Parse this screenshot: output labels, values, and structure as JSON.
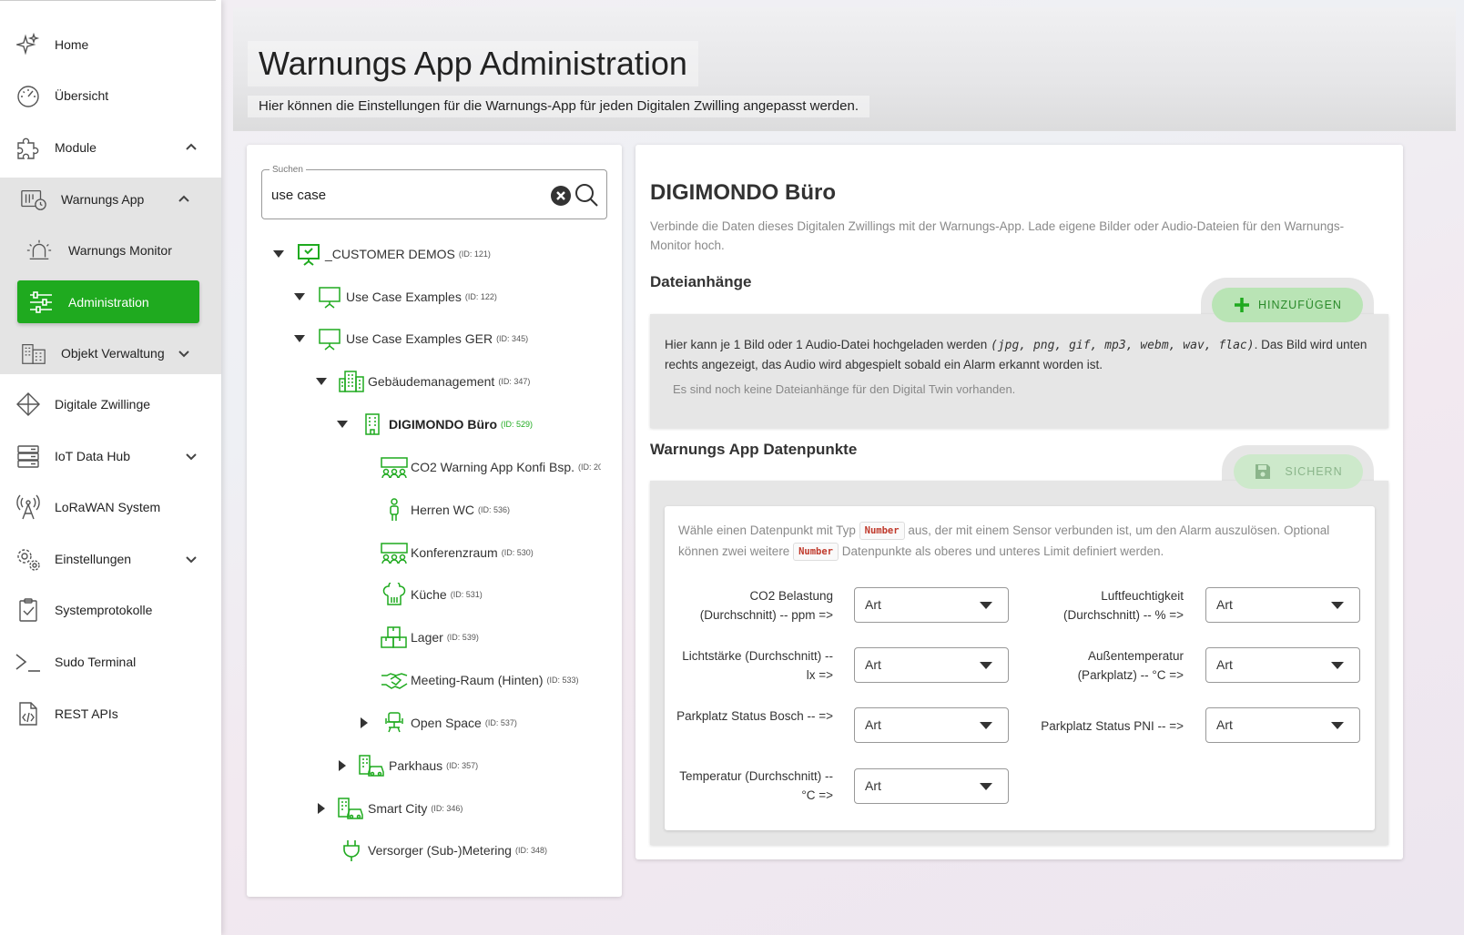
{
  "sidebar": {
    "items": [
      {
        "label": "Home",
        "icon": "sparkles-icon"
      },
      {
        "label": "Übersicht",
        "icon": "gauge-icon"
      },
      {
        "label": "Module",
        "icon": "puzzle-icon"
      },
      {
        "label": "Warnungs App",
        "icon": "alarm-app-icon"
      },
      {
        "label": "Warnungs Monitor",
        "icon": "siren-icon"
      },
      {
        "label": "Administration",
        "icon": "sliders-icon"
      },
      {
        "label": "Objekt Verwaltung",
        "icon": "buildings-icon"
      },
      {
        "label": "Digitale Zwillinge",
        "icon": "diamond-icon"
      },
      {
        "label": "IoT Data Hub",
        "icon": "server-icon"
      },
      {
        "label": "LoRaWAN System",
        "icon": "antenna-icon"
      },
      {
        "label": "Einstellungen",
        "icon": "gears-icon"
      },
      {
        "label": "Systemprotokolle",
        "icon": "clipboard-check-icon"
      },
      {
        "label": "Sudo Terminal",
        "icon": "terminal-icon"
      },
      {
        "label": "REST APIs",
        "icon": "code-file-icon"
      }
    ]
  },
  "header": {
    "title": "Warnungs App Administration",
    "subtitle": "Hier können die Einstellungen für die Warnungs-App für jeden Digitalen Zwilling angepasst werden."
  },
  "search": {
    "legend": "Suchen",
    "value": "use case"
  },
  "tree": [
    {
      "name": "_CUSTOMER DEMOS",
      "id": "(ID: 121)"
    },
    {
      "name": "Use Case Examples",
      "id": "(ID: 122)"
    },
    {
      "name": "Use Case Examples GER",
      "id": "(ID: 345)"
    },
    {
      "name": "Gebäudemanagement",
      "id": "(ID: 347)"
    },
    {
      "name": "DIGIMONDO Büro",
      "id": "(ID: 529)"
    },
    {
      "name": "CO2 Warning App Konfi Bsp.",
      "id": "(ID: 20"
    },
    {
      "name": "Herren WC",
      "id": "(ID: 536)"
    },
    {
      "name": "Konferenzraum",
      "id": "(ID: 530)"
    },
    {
      "name": "Küche",
      "id": "(ID: 531)"
    },
    {
      "name": "Lager",
      "id": "(ID: 539)"
    },
    {
      "name": "Meeting-Raum (Hinten)",
      "id": "(ID: 533)"
    },
    {
      "name": "Open Space",
      "id": "(ID: 537)"
    },
    {
      "name": "Parkhaus",
      "id": "(ID: 357)"
    },
    {
      "name": "Smart City",
      "id": "(ID: 346)"
    },
    {
      "name": "Versorger (Sub-)Metering",
      "id": "(ID: 348)"
    }
  ],
  "detail": {
    "title": "DIGIMONDO Büro",
    "description": "Verbinde die Daten dieses Digitalen Zwillings mit der Warnungs-App. Lade eigene Bilder oder Audio-Dateien für den Warnungs-Monitor hoch.",
    "attachments": {
      "title": "Dateianhänge",
      "add_label": "HINZUFÜGEN",
      "info_prefix": "Hier kann je 1 Bild oder 1 Audio-Datei hochgeladen werden ",
      "info_formats": "(jpg, png, gif, mp3, webm, wav, flac)",
      "info_suffix": ". Das Bild wird unten rechts angezeigt, das Audio wird abgespielt sobald ein Alarm erkannt worden ist.",
      "empty": "Es sind noch keine Dateianhänge für den Digital Twin vorhanden."
    },
    "datapoints": {
      "title": "Warnungs App Datenpunkte",
      "save_label": "SICHERN",
      "info_1": "Wähle einen Datenpunkt mit Typ ",
      "type_chip": "Number",
      "info_2": " aus, der mit einem Sensor verbunden ist, um den Alarm auszulösen. Optional können zwei weitere ",
      "info_3": " Datenpunkte als oberes und unteres Limit definiert werden.",
      "fields": [
        {
          "label": "CO2 Belastung (Durchschnitt) -- ppm =>",
          "value": "Art"
        },
        {
          "label": "Luftfeuchtigkeit (Durchschnitt) -- % =>",
          "value": "Art"
        },
        {
          "label": "Lichtstärke (Durchschnitt) -- lx =>",
          "value": "Art"
        },
        {
          "label": "Außentemperatur (Parkplatz) -- °C =>",
          "value": "Art"
        },
        {
          "label": "Parkplatz Status Bosch -- =>",
          "value": "Art"
        },
        {
          "label": "Parkplatz Status PNI -- =>",
          "value": "Art"
        },
        {
          "label": "Temperatur (Durchschnitt) -- °C =>",
          "value": "Art"
        }
      ]
    }
  },
  "colors": {
    "accent": "#1faa1f",
    "add_button_bg": "#b9e4b5",
    "save_button_bg": "#cde9cb",
    "panel_grey": "#e6e6e6"
  }
}
